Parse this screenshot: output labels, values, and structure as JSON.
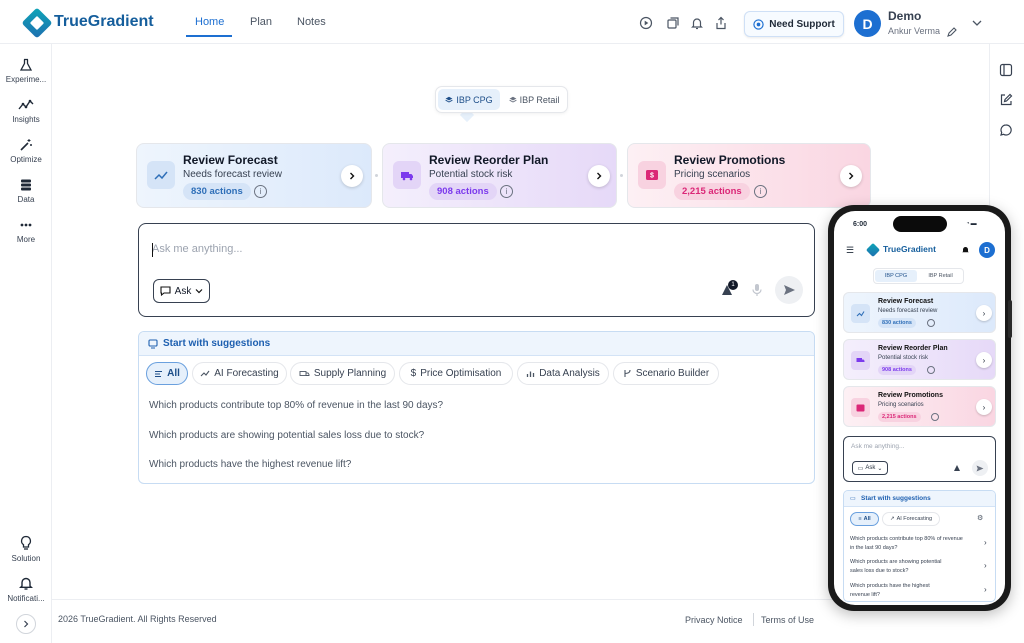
{
  "brand": {
    "name": "TrueGradient"
  },
  "nav": {
    "tabs": [
      {
        "label": "Home"
      },
      {
        "label": "Plan"
      },
      {
        "label": "Notes"
      }
    ]
  },
  "header": {
    "support_label": "Need Support"
  },
  "user": {
    "initial": "D",
    "name": "Demo",
    "subtitle": "Ankur Verma"
  },
  "sidebar": {
    "items": [
      {
        "label": "Experime...",
        "icon": "flask-icon"
      },
      {
        "label": "Insights",
        "icon": "insights-icon"
      },
      {
        "label": "Optimize",
        "icon": "magic-wand-icon"
      },
      {
        "label": "Data",
        "icon": "database-icon"
      },
      {
        "label": "More",
        "icon": "more-dots-icon"
      }
    ],
    "bottom": [
      {
        "label": "Solution",
        "icon": "lightbulb-icon"
      },
      {
        "label": "Notificati...",
        "icon": "bell-icon"
      }
    ]
  },
  "switcher": {
    "options": [
      {
        "label": "IBP CPG",
        "active": true
      },
      {
        "label": "IBP Retail",
        "active": false
      }
    ]
  },
  "cards": [
    {
      "title": "Review Forecast",
      "subtitle": "Needs forecast review",
      "count": "830 actions",
      "color": "#3b82c4",
      "icon": "trend-up-icon"
    },
    {
      "title": "Review Reorder Plan",
      "subtitle": "Potential stock risk",
      "count": "908 actions",
      "color": "#8b3fd6",
      "icon": "truck-icon"
    },
    {
      "title": "Review Promotions",
      "subtitle": "Pricing scenarios",
      "count": "2,215 actions",
      "color": "#d6336c",
      "icon": "price-tag-icon"
    }
  ],
  "ask": {
    "placeholder": "Ask me anything...",
    "mode_label": "Ask",
    "notification_count": "1"
  },
  "suggestions": {
    "title": "Start with suggestions",
    "chips": [
      {
        "label": "All",
        "active": true
      },
      {
        "label": "AI Forecasting",
        "active": false
      },
      {
        "label": "Supply Planning",
        "active": false
      },
      {
        "label": "Price Optimisation",
        "active": false
      },
      {
        "label": "Data Analysis",
        "active": false
      },
      {
        "label": "Scenario Builder",
        "active": false
      }
    ],
    "questions": [
      "Which products contribute top 80% of revenue in the last 90 days?",
      "Which products are showing potential sales loss due to stock?",
      "Which products have the highest revenue lift?"
    ]
  },
  "footer": {
    "copyright": "2026 TrueGradient. All Rights Reserved",
    "privacy": "Privacy Notice",
    "terms": "Terms of Use"
  },
  "phone": {
    "time": "6:00",
    "questions": [
      [
        "Which products contribute top 80% of revenue",
        "in the last 90 days?"
      ],
      [
        "Which products are showing potential",
        "sales loss due to stock?"
      ],
      [
        "Which products have the highest",
        "revenue lift?"
      ]
    ]
  }
}
